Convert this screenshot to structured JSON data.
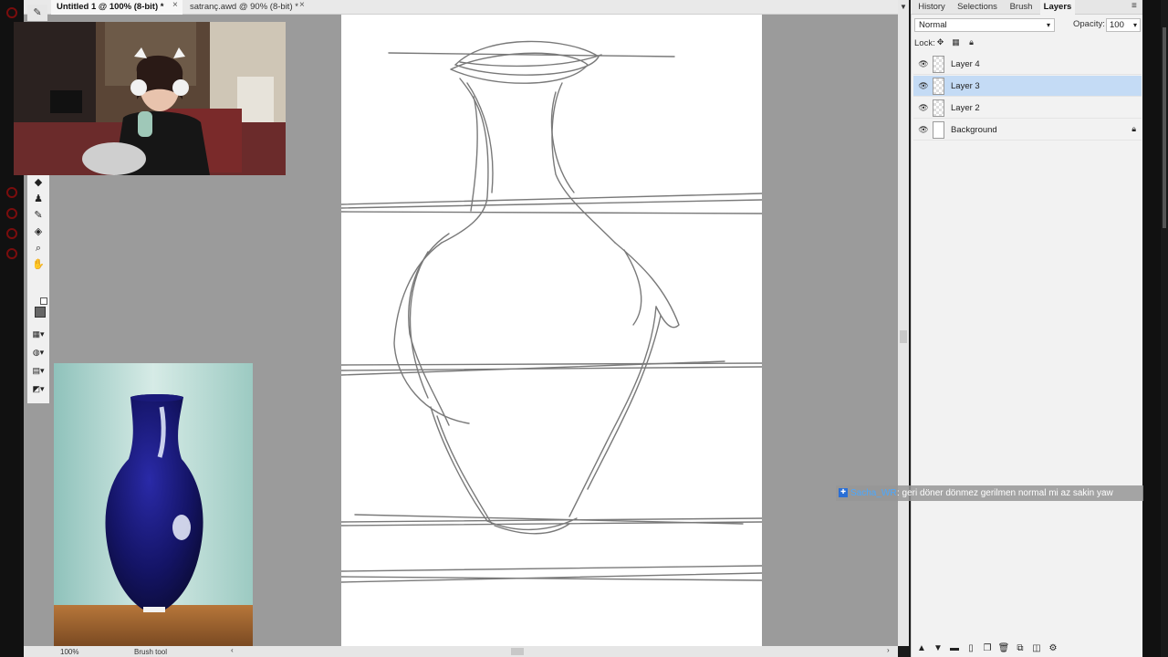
{
  "tabs": [
    {
      "label": "Untitled 1 @ 100% (8-bit) *",
      "active": true
    },
    {
      "label": "satranç.awd @ 90% (8-bit) *",
      "active": false
    }
  ],
  "tab_close_glyph": "×",
  "panel_tabs": [
    "History",
    "Selections",
    "Brush",
    "Layers"
  ],
  "panel_tab_active": "Layers",
  "layers_panel": {
    "blend_mode": "Normal",
    "opacity_label": "Opacity:",
    "opacity_value": "100",
    "lock_label": "Lock:",
    "layers": [
      {
        "name": "Layer 4",
        "visible": true,
        "selected": false,
        "locked": false
      },
      {
        "name": "Layer 3",
        "visible": true,
        "selected": true,
        "locked": false
      },
      {
        "name": "Layer 2",
        "visible": true,
        "selected": false,
        "locked": false
      },
      {
        "name": "Background",
        "visible": true,
        "selected": false,
        "locked": true
      }
    ]
  },
  "status": {
    "zoom": "100%",
    "tool": "Brush tool"
  },
  "chat": {
    "user": "Sacha_WR",
    "message": ": geri döner dönmez gerilmen normal mi az sakin yaw"
  },
  "icons": {
    "brush": "brush-icon",
    "eraser": "eraser-icon",
    "stamp": "stamp-icon",
    "pipette": "eyedropper-icon",
    "bucket": "fill-bucket-icon",
    "zoom": "zoom-icon",
    "hand": "hand-icon",
    "eye": "eye-icon",
    "lock": "lock-icon"
  },
  "colors": {
    "selection": "#c4dbf5",
    "accent_red": "#7a0d0d",
    "workspace": "#9b9b9b"
  }
}
